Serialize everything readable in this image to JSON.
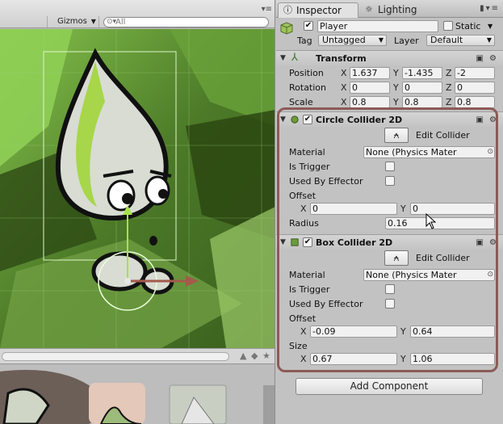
{
  "colors": {
    "scene_bg_dark": "#2f4d18",
    "scene_bg_light": "#7dbb3f",
    "character_green": "#a7d64a",
    "annotation_border": "#8c5b57",
    "field_bg": "#f1f1f1"
  },
  "scene": {
    "gizmos_label": "Gizmos",
    "search_placeholder": "All",
    "menu_icon": "menu-lines-icon"
  },
  "inspector": {
    "tabs": [
      {
        "label": "Inspector",
        "icon": "info-icon",
        "active": true
      },
      {
        "label": "Lighting",
        "icon": "lighting-icon",
        "active": false
      }
    ],
    "object": {
      "name": "Player",
      "active": true,
      "static_label": "Static",
      "static": false,
      "tag_label": "Tag",
      "tag_value": "Untagged",
      "layer_label": "Layer",
      "layer_value": "Default"
    },
    "transform": {
      "title": "Transform",
      "rows": [
        {
          "label": "Position",
          "x": "1.637",
          "y": "-1.435",
          "z": "-2"
        },
        {
          "label": "Rotation",
          "x": "0",
          "y": "0",
          "z": "0"
        },
        {
          "label": "Scale",
          "x": "0.8",
          "y": "0.8",
          "z": "0.8"
        }
      ]
    },
    "circle_collider": {
      "title": "Circle Collider 2D",
      "enabled": true,
      "edit_collider_label": "Edit Collider",
      "material_label": "Material",
      "material_value": "None (Physics Mater",
      "is_trigger_label": "Is Trigger",
      "is_trigger": false,
      "used_by_effector_label": "Used By Effector",
      "used_by_effector": false,
      "offset_label": "Offset",
      "offset_x": "0",
      "offset_y": "0",
      "radius_label": "Radius",
      "radius_value": "0.16"
    },
    "box_collider": {
      "title": "Box Collider 2D",
      "enabled": true,
      "edit_collider_label": "Edit Collider",
      "material_label": "Material",
      "material_value": "None (Physics Mater",
      "is_trigger_label": "Is Trigger",
      "is_trigger": false,
      "used_by_effector_label": "Used By Effector",
      "used_by_effector": false,
      "offset_label": "Offset",
      "offset_x": "-0.09",
      "offset_y": "0.64",
      "size_label": "Size",
      "size_x": "0.67",
      "size_y": "1.06"
    },
    "axis_labels": {
      "x": "X",
      "y": "Y",
      "z": "Z"
    },
    "add_component_label": "Add Component"
  }
}
